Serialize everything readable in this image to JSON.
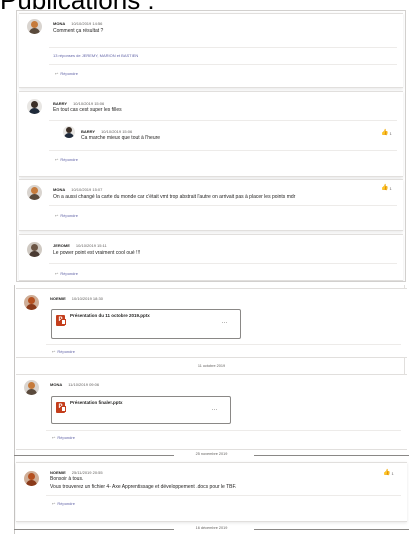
{
  "page": {
    "title": "Publications :"
  },
  "accent": "#6264a7",
  "like_color": "#f2c811",
  "posts": [
    {
      "author": "MONA",
      "date": "10/10/2019 14:56",
      "message": "Comment ça résultat ?",
      "replies_summary": "13 réponses de JEREMY, MARION et BASTIEN",
      "reply_label": "Répondre",
      "avatar_icon": "avatar-mona"
    },
    {
      "author": "BARRY",
      "date": "10/10/2019 15:06",
      "message": "En tout cas cest super les filles",
      "reply_label": "Répondre",
      "avatar_icon": "avatar-barry",
      "nested_reply": {
        "author": "BARRY",
        "date": "10/10/2019 15:06",
        "message": "Ca marche mieux que tout à l'heure",
        "likes": "1"
      }
    },
    {
      "author": "MONA",
      "date": "10/10/2019 15:07",
      "message": "On a aussi changé la carte du monde car c'était vmt trop abstrait l'autre on arrivait pas à placer les points mdr",
      "likes": "1",
      "reply_label": "Répondre",
      "avatar_icon": "avatar-mona"
    },
    {
      "author": "JEROME",
      "date": "10/10/2019 15:11",
      "message": "Le power point est vraiment cool oué !!!",
      "reply_label": "Répondre",
      "avatar_icon": "avatar-jerome"
    },
    {
      "author": "NOEMIE",
      "date": "10/10/2019 18:30",
      "file_name": "Présentation du 11 octobre 2019.pptx",
      "file_more": "...",
      "reply_label": "Répondre",
      "avatar_icon": "avatar-noemie"
    },
    {
      "author": "MONA",
      "date": "11/10/2019 09:06",
      "file_name": "Présentation finale!.pptx",
      "file_more": "...",
      "reply_label": "Répondre",
      "avatar_icon": "avatar-mona"
    },
    {
      "author": "NOEMIE",
      "date": "25/11/2019 20:55",
      "message_lines": [
        "Bonsoir à tous.",
        "Vous trouverez un fichier 4- Axe Apprentissage et développement .docs pour le TBF."
      ],
      "likes": "1",
      "reply_label": "Répondre",
      "avatar_icon": "avatar-noemie"
    }
  ],
  "date_separators": [
    "11 octobre 2019",
    "25 novembre 2019",
    "16 décembre 2019"
  ]
}
